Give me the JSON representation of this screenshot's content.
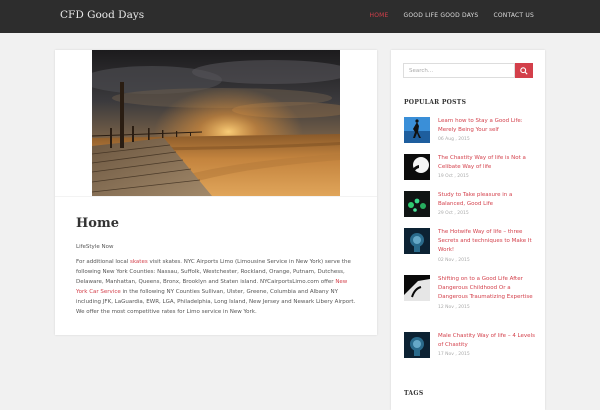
{
  "site": {
    "title": "CFD Good Days"
  },
  "nav": [
    {
      "label": "HOME",
      "active": true
    },
    {
      "label": "GOOD LIFE GOOD DAYS",
      "active": false
    },
    {
      "label": "CONTACT US",
      "active": false
    }
  ],
  "main": {
    "title": "Home",
    "subtitle": "LifeStyle Now",
    "body": {
      "t1": "For additional local ",
      "link1": "skates",
      "t2": " visit skates. NYC Airports Limo (Limousine Service in New York) serve the following New York Counties: Nassau, Suffolk, Westchester, Rockland, Orange, Putnam, Dutchess, Delaware, Manhattan, Queens, Bronx, Brooklyn and Staten island. NYCairportsLimo.com offer ",
      "link2": "New York Car Service",
      "t3": " in the following NY Counties Sullivan, Ulster, Greene, Columbia and Albany NY including JFK, LaGuardia, EWR, LGA, Philadelphia, Long Island, New Jersey and Newark Libery Airport. We offer the most competitive rates for Limo service in New York."
    }
  },
  "sidebar": {
    "search": {
      "placeholder": "Search..."
    },
    "popular_title": "POPULAR POSTS",
    "posts": [
      {
        "title": "Learn how to Stay a Good Life: Merely Being Your self",
        "date": "06 Aug , 2015"
      },
      {
        "title": "The Chastity Way of life is Not a Celibate Way of life",
        "date": "19 Oct , 2015"
      },
      {
        "title": "Study to Take pleasure in a Balanced, Good Life",
        "date": "29 Oct , 2015"
      },
      {
        "title": "The Hotwife Way of life – three Secrets and techniques to Make It Work!",
        "date": "02 Nov , 2015"
      },
      {
        "title": "Shifting on to a Good Life After Dangerous Childhood Or a Dangerous Traumatizing Expertise",
        "date": "12 Nov , 2015"
      },
      {
        "title": "Male Chastity Way of life – 4 Levels of Chastity",
        "date": "17 Nov , 2015"
      }
    ],
    "tags_title": "TAGS"
  },
  "colors": {
    "accent": "#d33f4a",
    "header_bg": "#2d2d2d",
    "page_bg": "#f1f1f1"
  }
}
